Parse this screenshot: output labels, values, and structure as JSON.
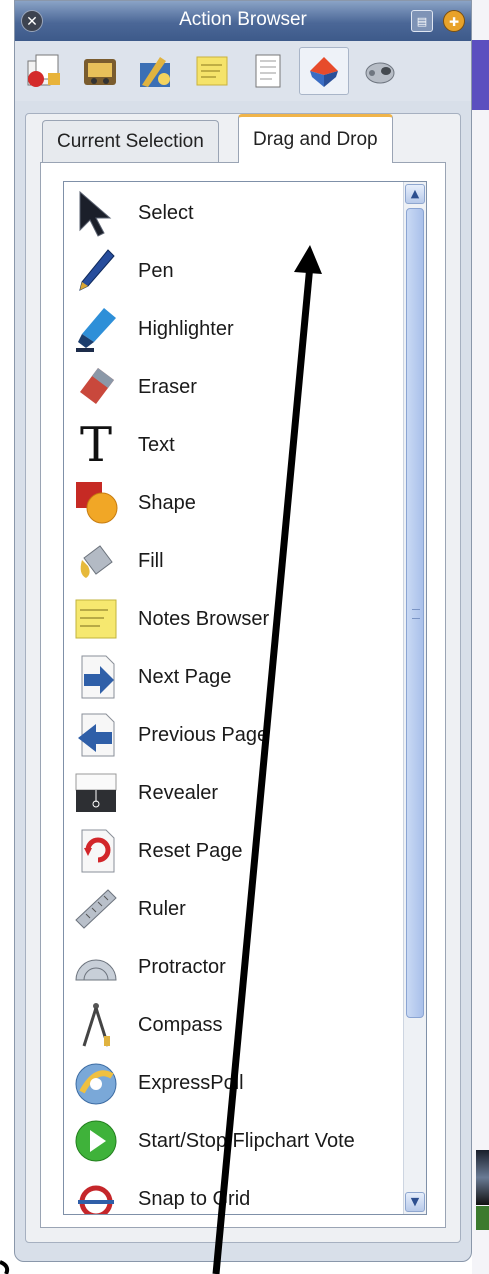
{
  "window": {
    "title": "Action Browser",
    "close_icon": "close-icon",
    "menu_icon": "menu-icon",
    "pin_icon": "pin-icon"
  },
  "toolbar": {
    "icons": [
      "resource-browser-icon",
      "media-icon",
      "property-browser-icon",
      "notes-browser-icon",
      "object-browser-icon",
      "action-browser-icon",
      "voting-browser-icon"
    ],
    "active_index": 5
  },
  "tabs": [
    {
      "label": "Current Selection",
      "active": false
    },
    {
      "label": "Drag and Drop",
      "active": true
    }
  ],
  "actions": [
    {
      "label": "Select",
      "icon": "cursor-arrow-icon"
    },
    {
      "label": "Pen",
      "icon": "pen-icon"
    },
    {
      "label": "Highlighter",
      "icon": "highlighter-icon"
    },
    {
      "label": "Eraser",
      "icon": "eraser-icon"
    },
    {
      "label": "Text",
      "icon": "text-icon"
    },
    {
      "label": "Shape",
      "icon": "shape-icon"
    },
    {
      "label": "Fill",
      "icon": "fill-bucket-icon"
    },
    {
      "label": "Notes Browser",
      "icon": "sticky-note-icon"
    },
    {
      "label": "Next Page",
      "icon": "next-page-icon"
    },
    {
      "label": "Previous Page",
      "icon": "previous-page-icon"
    },
    {
      "label": "Revealer",
      "icon": "revealer-icon"
    },
    {
      "label": "Reset Page",
      "icon": "reset-page-icon"
    },
    {
      "label": "Ruler",
      "icon": "ruler-icon"
    },
    {
      "label": "Protractor",
      "icon": "protractor-icon"
    },
    {
      "label": "Compass",
      "icon": "compass-icon"
    },
    {
      "label": "ExpressPoll",
      "icon": "expresspoll-icon"
    },
    {
      "label": "Start/Stop Flipchart Vote",
      "icon": "play-vote-icon"
    },
    {
      "label": "Snap to Grid",
      "icon": "snap-to-grid-icon"
    }
  ],
  "colors": {
    "titlebar": "#4b6797",
    "tab_accent": "#f0b44a",
    "annotation_arrow": "#000000"
  }
}
